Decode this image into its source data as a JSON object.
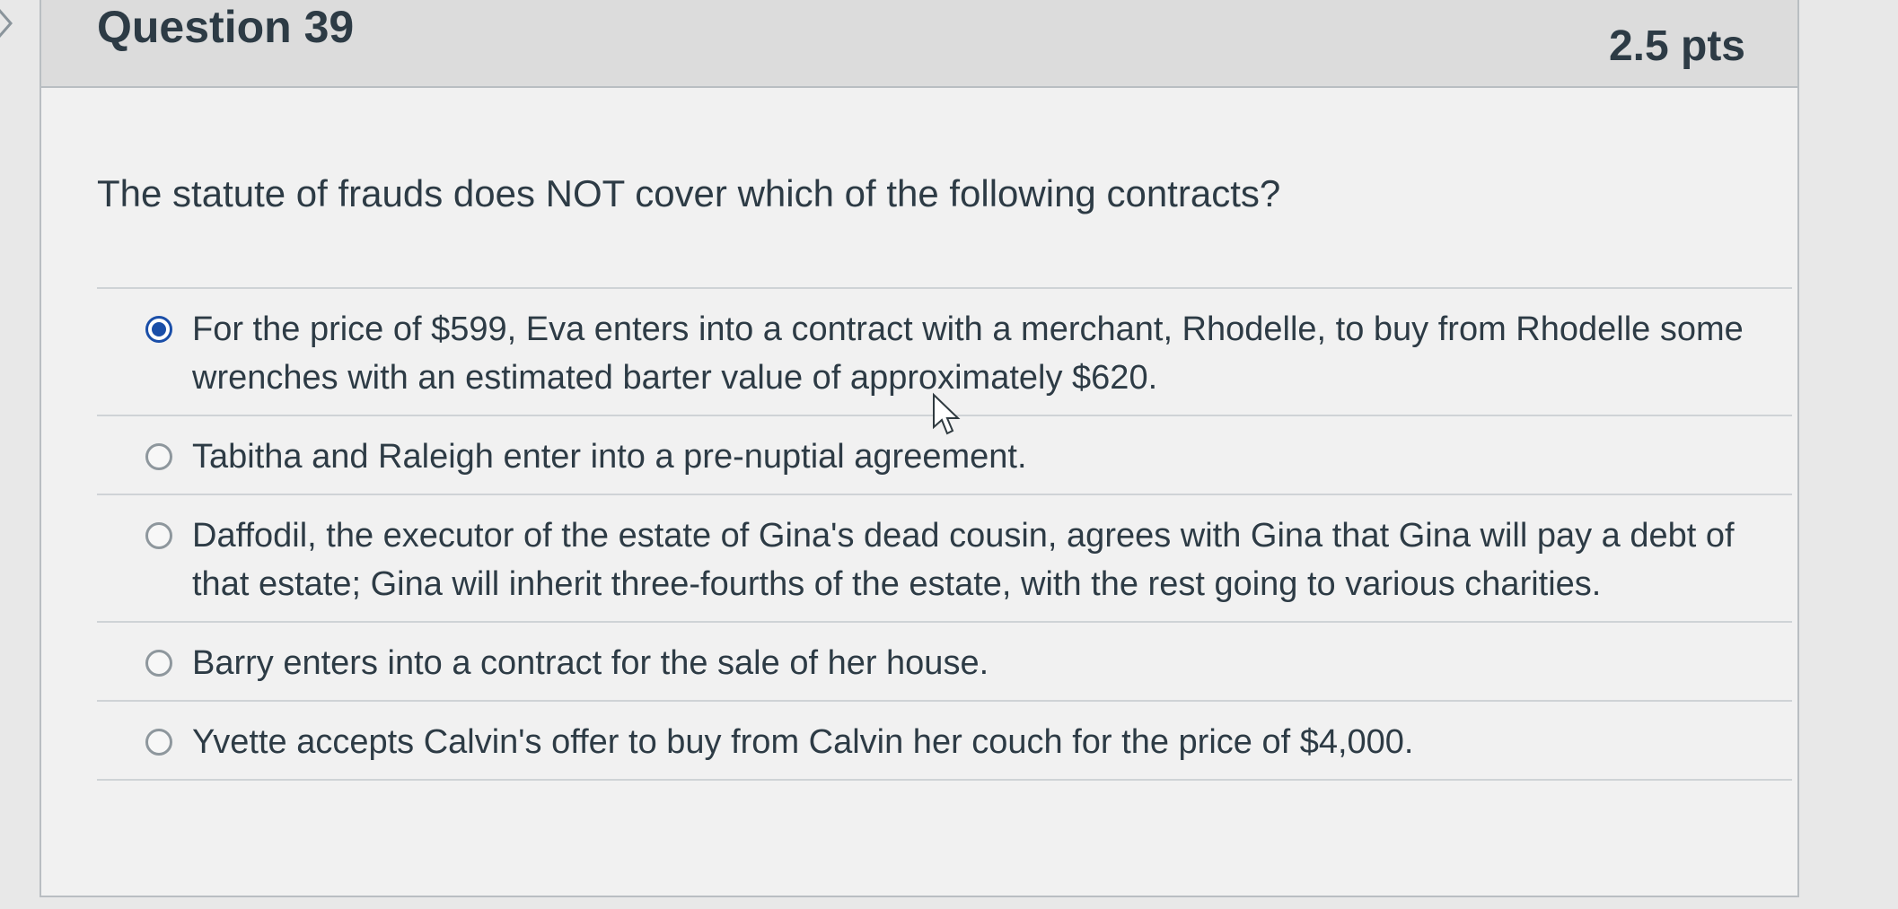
{
  "question": {
    "title": "Question 39",
    "points": "2.5 pts",
    "prompt": "The statute of frauds does NOT cover which of the following contracts?"
  },
  "answers": [
    {
      "label": "For the price of $599, Eva enters into a contract with a merchant, Rhodelle, to buy from Rhodelle some wrenches with an estimated barter value of approximately $620.",
      "selected": true
    },
    {
      "label": "Tabitha and Raleigh enter into a pre-nuptial agreement.",
      "selected": false
    },
    {
      "label": "Daffodil, the executor of the estate of Gina's dead cousin, agrees with Gina that Gina will pay a debt of that estate; Gina will inherit three-fourths of the estate, with the rest going to various charities.",
      "selected": false
    },
    {
      "label": "Barry enters into a contract for the sale of her house.",
      "selected": false
    },
    {
      "label": "Yvette accepts Calvin's offer to buy from Calvin her couch for the price of $4,000.",
      "selected": false
    }
  ],
  "colors": {
    "selected_radio": "#1a4ea8",
    "text": "#2d3b45"
  },
  "icons": {
    "toggle": "chevron-right-icon",
    "cursor": "mouse-pointer-icon"
  }
}
